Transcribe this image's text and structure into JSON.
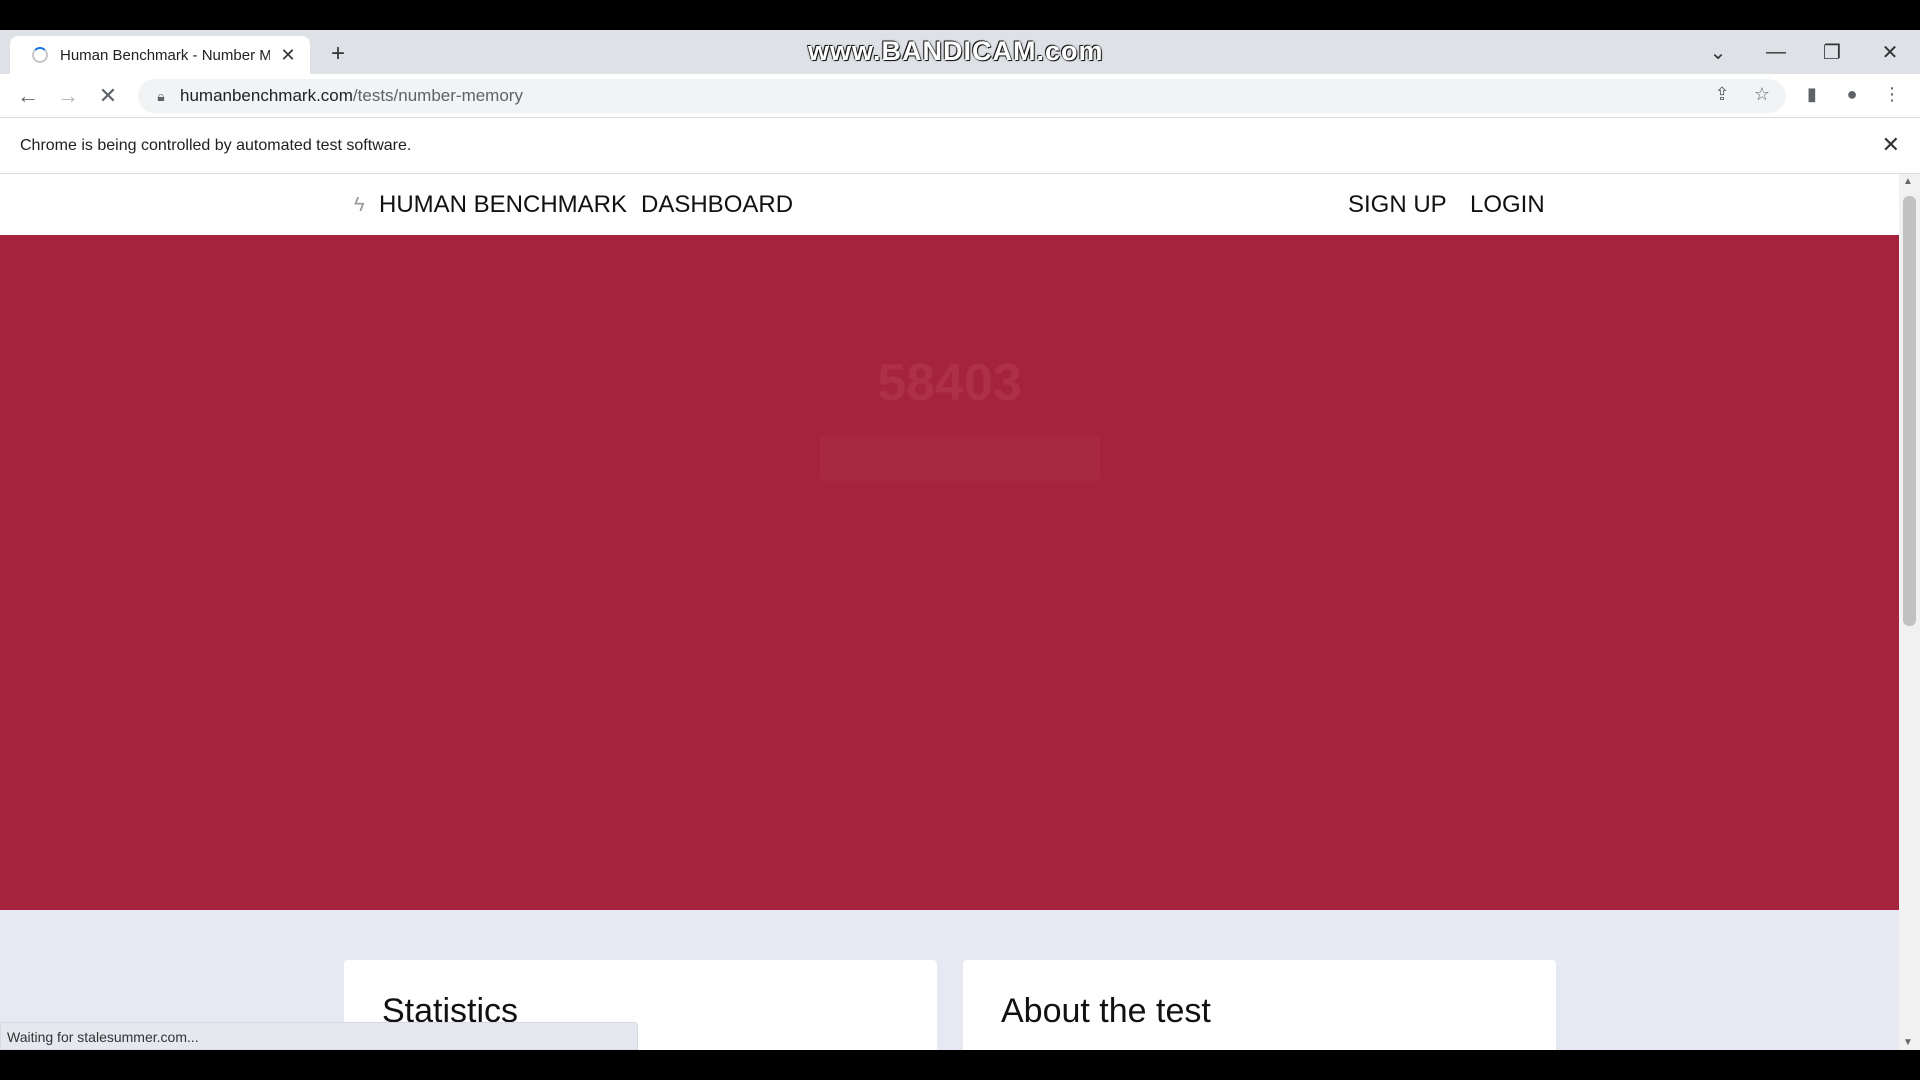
{
  "browser": {
    "tab_title": "Human Benchmark - Number Me",
    "watermark": "www.BANDICAM.com",
    "url_host": "humanbenchmark.com",
    "url_path": "/tests/number-memory",
    "infobar_message": "Chrome is being controlled by automated test software.",
    "status_text": "Waiting for stalesummer.com..."
  },
  "nav": {
    "brand": "HUMAN BENCHMARK",
    "dashboard": "DASHBOARD",
    "signup": "SIGN UP",
    "login": "LOGIN"
  },
  "hero": {
    "faded_number": "58403",
    "background_color": "#a5233d"
  },
  "cards": {
    "statistics_title": "Statistics",
    "about_title": "About the test"
  },
  "icons": {
    "back": "back-arrow-icon",
    "forward": "forward-arrow-icon",
    "stop": "stop-loading-icon",
    "lock": "lock-icon",
    "share": "share-icon",
    "star": "bookmark-star-icon",
    "sidepanel": "side-panel-icon",
    "profile": "profile-icon",
    "menu": "kebab-menu-icon"
  }
}
